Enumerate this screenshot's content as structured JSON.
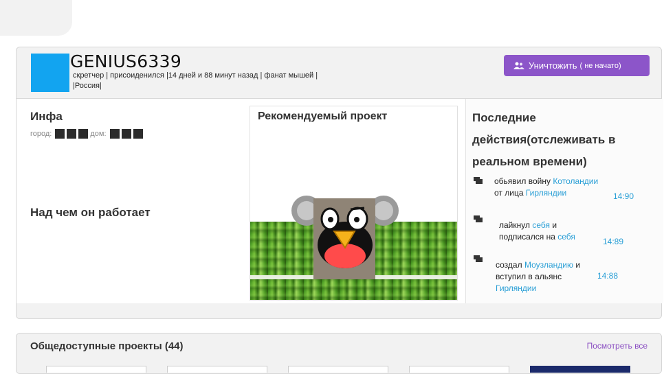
{
  "profile": {
    "username": "GENIUS6339",
    "meta_line1": "скретчер | присоиденился |14 дней и 88 минут назад | фанат мышей  |",
    "meta_line2": "|Россия|",
    "avatar_color": "#12a4f0",
    "destroy_button": {
      "label": "Уничтожить",
      "status": "( не начато)",
      "color": "#8c55c9"
    }
  },
  "info": {
    "title": "Инфа",
    "city_label": "город:",
    "home_label": "дом:",
    "working_title": "Над чем он работает"
  },
  "featured": {
    "title": "Рекомендуемый проект"
  },
  "activity": {
    "title": "Последние действия(отслеживать в реальном времени)",
    "items": [
      {
        "pre": "обьявил войну",
        "link1": "Котоландии",
        "mid": "от лица",
        "link2": "Гирляндии",
        "time": "14:90"
      },
      {
        "pre": "лайкнул",
        "link1": "себя",
        "mid": "и подписался на",
        "link2": "себя",
        "time": "14:89"
      },
      {
        "pre": "создал",
        "link1": "Моузландию",
        "mid": "и вступил в альянс",
        "link2": "Гирляндии",
        "time": "14:88"
      }
    ]
  },
  "projects": {
    "title": "Общедоступные проекты (44)",
    "see_all": "Посмотреть все"
  }
}
